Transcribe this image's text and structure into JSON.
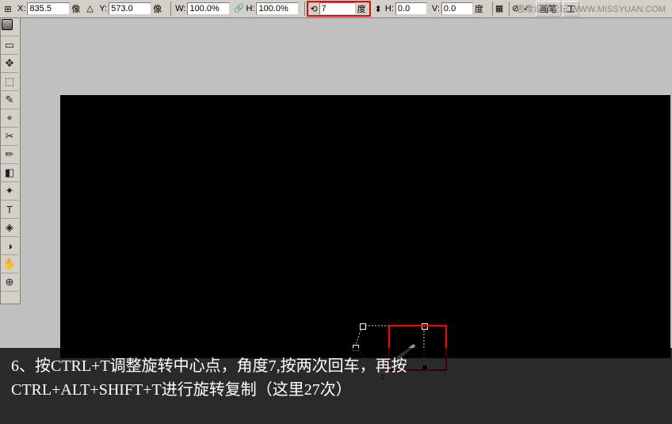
{
  "options": {
    "ref_icon": "⊞",
    "x_label": "X:",
    "x_value": "835.5",
    "x_unit": "像",
    "y_label": "Y:",
    "y_value": "573.0",
    "y_unit": "像",
    "w_label": "W:",
    "w_value": "100.0%",
    "link_icon": "🔗",
    "h_label": "H:",
    "h_value": "100.0%",
    "angle_icon": "⟲",
    "angle_value": "7",
    "angle_unit": "度",
    "skew_h_icon": "⬍",
    "skew_h_label": "H:",
    "skew_h_value": "0.0",
    "skew_v_label": "V:",
    "skew_v_value": "0.0",
    "skew_unit": "度",
    "brush_label": "画笔",
    "tool_opt": "工"
  },
  "watermark": "思缘设计论坛  WWW.MISSYUAN.COM",
  "tools": {
    "t0": "▭",
    "t1": "✥",
    "t2": "⬚",
    "t3": "✎",
    "t4": "⌖",
    "t5": "✂",
    "t6": "✏",
    "t7": "◧",
    "t8": "✦",
    "t9": "T",
    "t10": "◈",
    "t11": "◑",
    "t12": "✋",
    "t13": "⊕"
  },
  "caption": {
    "line1": "6、按CTRL+T调整旋转中心点，角度7,按两次回车，再按",
    "line2": "CTRL+ALT+SHIFT+T进行旋转复制（这里27次）"
  }
}
